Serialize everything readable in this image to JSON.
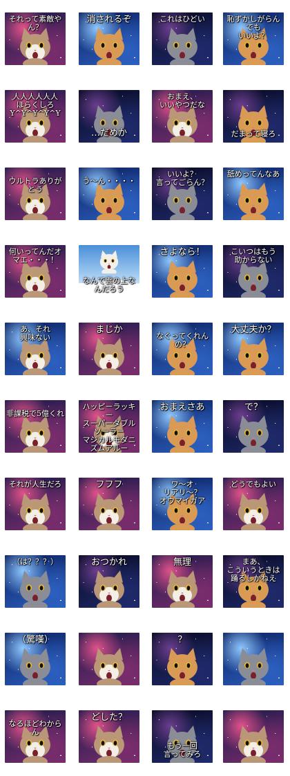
{
  "stickers": [
    {
      "caption": "それって素敵やん？",
      "pos": "top",
      "bg": "pinkcloud",
      "cat": "tabbywhite"
    },
    {
      "caption": "消されるぞ",
      "pos": "top",
      "bg": "blue",
      "cat": "orange"
    },
    {
      "caption": "これはひどい",
      "pos": "top",
      "bg": "deep",
      "cat": "grey"
    },
    {
      "caption": "恥ずかしがらんでも\nいいよ？",
      "pos": "top",
      "bg": "blue",
      "cat": "orange"
    },
    {
      "caption": "人人人人人人\nほらくしろ\nY^Y^Y^Y^Y",
      "pos": "top",
      "bg": "pinkcloud",
      "cat": "tabbywhite"
    },
    {
      "caption": "…だめか",
      "pos": "bot",
      "bg": "deep",
      "cat": "grey"
    },
    {
      "caption": "おまえ、\nいいやつだな",
      "pos": "top",
      "bg": "pinkcloud",
      "cat": "tabbywhite"
    },
    {
      "caption": "だまって寝ろ",
      "pos": "bot",
      "bg": "deep",
      "cat": "orange"
    },
    {
      "caption": "ウルトラありがとう",
      "pos": "mid",
      "bg": "pinkcloud",
      "cat": "tabbywhite"
    },
    {
      "caption": "う〜ん・・・・",
      "pos": "mid",
      "bg": "blue",
      "cat": "orange"
    },
    {
      "caption": "いいよ？\n言ってごらん？",
      "pos": "top",
      "bg": "deep",
      "cat": "grey"
    },
    {
      "caption": "舐めってんなあ",
      "pos": "top",
      "bg": "blue",
      "cat": "orange"
    },
    {
      "caption": "何いってんだオマエ・・・！",
      "pos": "top",
      "bg": "pinkcloud",
      "cat": "tabbywhite"
    },
    {
      "caption": "なんで雲の上なんだろう",
      "pos": "bot",
      "bg": "sky",
      "cat": "white"
    },
    {
      "caption": "さよなら！",
      "pos": "top",
      "bg": "blue",
      "cat": "orange"
    },
    {
      "caption": "こいつはもう\n助からない",
      "pos": "top",
      "bg": "deep",
      "cat": "grey"
    },
    {
      "caption": "あ、それ\n興味ない",
      "pos": "top",
      "bg": "blue",
      "cat": "tabbywhite"
    },
    {
      "caption": "まじか",
      "pos": "top",
      "bg": "pinkcloud",
      "cat": "tabbywhite"
    },
    {
      "caption": "なぐってくれんの？",
      "pos": "mid",
      "bg": "blue",
      "cat": "orange"
    },
    {
      "caption": "大丈夫か？",
      "pos": "top",
      "bg": "blue",
      "cat": "orange"
    },
    {
      "caption": "非課税で5億くれ",
      "pos": "mid",
      "bg": "pinkcloud",
      "cat": "tabbywhite"
    },
    {
      "caption": "ハッピーラッキー\nスーパーダブルソーラー\nマジカルモダニズムアルー",
      "pos": "top",
      "bg": "pinkcloud",
      "cat": "tabbywhite"
    },
    {
      "caption": "おまえさあ",
      "pos": "top",
      "bg": "blue",
      "cat": "orange"
    },
    {
      "caption": "で？",
      "pos": "top",
      "bg": "deep",
      "cat": "grey"
    },
    {
      "caption": "それが人生だろ",
      "pos": "top",
      "bg": "pinkcloud",
      "cat": "tabbywhite"
    },
    {
      "caption": "フフフ",
      "pos": "top",
      "bg": "pinkcloud",
      "cat": "tabbywhite"
    },
    {
      "caption": "ワ〜オ\nリアリ〜？\nオウマイガア",
      "pos": "top",
      "bg": "blue",
      "cat": "orange"
    },
    {
      "caption": "どうでもよい",
      "pos": "top",
      "bg": "pinkcloud",
      "cat": "tabbywhite"
    },
    {
      "caption": "（は？？？）",
      "pos": "top",
      "bg": "blue",
      "cat": "grey"
    },
    {
      "caption": "おつかれ",
      "pos": "top",
      "bg": "deep",
      "cat": "tabbywhite"
    },
    {
      "caption": "無理",
      "pos": "top",
      "bg": "pinkcloud",
      "cat": "tabbywhite"
    },
    {
      "caption": "まあ、\nこういうときは\n踊るしかねえ",
      "pos": "top",
      "bg": "deep",
      "cat": "orange"
    },
    {
      "caption": "（驚嘆）",
      "pos": "top",
      "bg": "blue",
      "cat": "grey"
    },
    {
      "caption": "",
      "pos": "top",
      "bg": "pinkcloud",
      "cat": "tabbywhite"
    },
    {
      "caption": "？",
      "pos": "top",
      "bg": "deep",
      "cat": "orange"
    },
    {
      "caption": "",
      "pos": "top",
      "bg": "blue",
      "cat": "grey"
    },
    {
      "caption": "なるほどわからん",
      "pos": "mid",
      "bg": "pinkcloud",
      "cat": "tabbywhite"
    },
    {
      "caption": "どした？",
      "pos": "top",
      "bg": "pinkcloud",
      "cat": "tabbywhite"
    },
    {
      "caption": "もう一回\n言ってみろ",
      "pos": "bot",
      "bg": "deep",
      "cat": "grey"
    },
    {
      "caption": "",
      "pos": "top",
      "bg": "pinkcloud",
      "cat": "tabbywhite"
    }
  ],
  "colors": {
    "pinkcloud": [
      "#1b1a4a",
      "#7a2d6d",
      "#e0528a"
    ],
    "blue": [
      "#0b1f5c",
      "#2c5fbf",
      "#8ec7ff"
    ],
    "deep": [
      "#07091f",
      "#1f2a6b",
      "#6b3e8e"
    ],
    "sky": [
      "#4a8fd8",
      "#9fc9f0",
      "#ffffff"
    ],
    "orange_cat": "#d99a55",
    "grey_cat": "#8a8d95",
    "white_cat": "#f3f0ea",
    "tabby_cat": "#b99777"
  }
}
